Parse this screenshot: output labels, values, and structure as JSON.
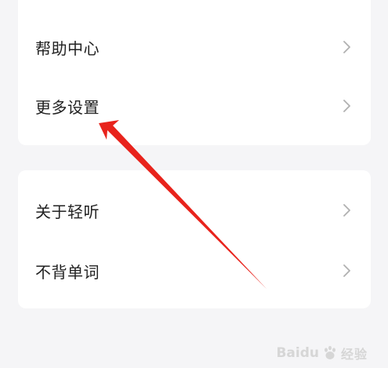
{
  "menu_group_1": {
    "items": [
      {
        "label": "帮助中心"
      },
      {
        "label": "更多设置"
      }
    ]
  },
  "menu_group_2": {
    "items": [
      {
        "label": "关于轻听"
      },
      {
        "label": "不背单词"
      }
    ]
  },
  "watermark": {
    "brand": "Baidu",
    "suffix": "经验"
  },
  "colors": {
    "background": "#f5f5f7",
    "card": "#ffffff",
    "chevron": "#b0b0b0",
    "annotation_arrow": "#e8231c",
    "watermark": "#d6d6d6"
  },
  "icons": {
    "row_chevron": "chevron-right-icon",
    "annotation": "red-arrow-annotation",
    "watermark_logo": "baidu-paw-icon"
  }
}
